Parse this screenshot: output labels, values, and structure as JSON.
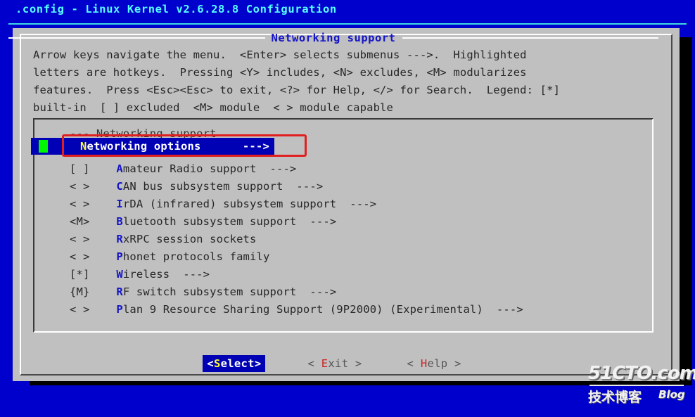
{
  "screen": {
    "background_color": "#0000cc",
    "title": ".config - Linux Kernel v2.6.28.8 Configuration",
    "title_color": "#55ffff"
  },
  "dialog": {
    "title": "Networking support",
    "title_color": "#1414c8",
    "background_color": "#c0c0c0",
    "help_text": "Arrow keys navigate the menu.  <Enter> selects submenus --->.  Highlighted\nletters are hotkeys.  Pressing <Y> includes, <N> excludes, <M> modularizes\nfeatures.  Press <Esc><Esc> to exit, <?> for Help, </> for Search.  Legend: [*]\nbuilt-in  [ ] excluded  <M> module  < > module capable"
  },
  "menu": {
    "comment_row": "--- Networking support",
    "selected": {
      "marker": "",
      "hotkey": "N",
      "label_rest": "etworking options",
      "submenu_arrow": "--->",
      "highlight_color": "#0000b4",
      "cursor_color": "#00f700",
      "hotkey_color": "#ffff33"
    },
    "items": [
      {
        "marker": "[ ]",
        "hotkey": "A",
        "label_rest": "mateur Radio support",
        "submenu_arrow": "--->"
      },
      {
        "marker": "< >",
        "hotkey": "C",
        "label_rest": "AN bus subsystem support",
        "submenu_arrow": "--->"
      },
      {
        "marker": "< >",
        "hotkey": "I",
        "label_rest": "rDA (infrared) subsystem support",
        "submenu_arrow": "--->"
      },
      {
        "marker": "<M>",
        "hotkey": "B",
        "label_rest": "luetooth subsystem support",
        "submenu_arrow": "--->"
      },
      {
        "marker": "< >",
        "hotkey": "R",
        "label_rest": "xRPC session sockets",
        "submenu_arrow": ""
      },
      {
        "marker": "< >",
        "hotkey": "P",
        "label_rest": "honet protocols family",
        "submenu_arrow": ""
      },
      {
        "marker": "[*]",
        "hotkey": "W",
        "label_rest": "ireless",
        "submenu_arrow": "--->"
      },
      {
        "marker": "{M}",
        "hotkey": "R",
        "label_rest": "F switch subsystem support",
        "submenu_arrow": "--->"
      },
      {
        "marker": "< >",
        "hotkey": "P",
        "label_rest": "lan 9 Resource Sharing Support (9P2000) (Experimental)",
        "submenu_arrow": "--->"
      }
    ]
  },
  "buttons": [
    {
      "name": "select",
      "prefix": "<",
      "hotkey": "S",
      "rest": "elect",
      "suffix": ">",
      "selected": true
    },
    {
      "name": "exit",
      "prefix": "< ",
      "hotkey": "E",
      "rest": "xit",
      "suffix": " >",
      "selected": false
    },
    {
      "name": "help",
      "prefix": "< ",
      "hotkey": "H",
      "rest": "elp",
      "suffix": " >",
      "selected": false
    }
  ],
  "watermark": {
    "main": "51CTO.com",
    "chinese": "技术博客",
    "blog": "Blog"
  }
}
